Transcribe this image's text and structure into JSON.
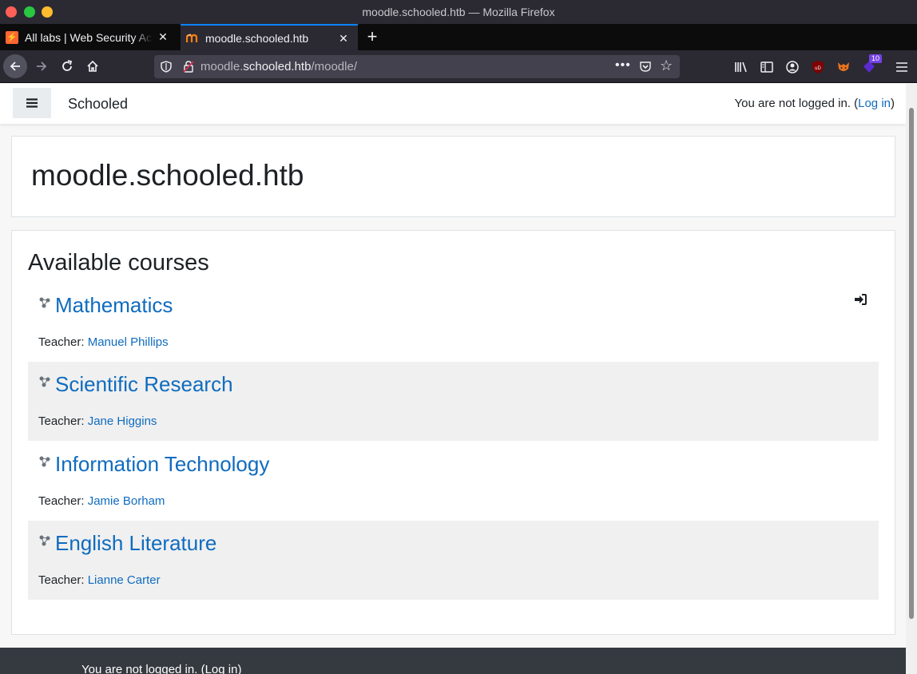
{
  "window": {
    "title": "moodle.schooled.htb — Mozilla Firefox"
  },
  "tabs": [
    {
      "label": "All labs | Web Security Academy",
      "favicon": "web-security-academy-icon"
    },
    {
      "label": "moodle.schooled.htb",
      "favicon": "moodle-icon",
      "active": true
    }
  ],
  "urlbar": {
    "host": "moodle.schooled.htb",
    "prefix": "moodle.",
    "domain": "schooled.htb",
    "path": "/moodle/"
  },
  "toolbar": {
    "extension_badge": "10"
  },
  "moodle_nav": {
    "site_name": "Schooled",
    "login_prefix": "You are not logged in. (",
    "login_link": "Log in",
    "login_suffix": ")"
  },
  "header": {
    "title": "moodle.schooled.htb"
  },
  "courses_section": {
    "title": "Available courses",
    "teacher_label": "Teacher: ",
    "courses": [
      {
        "name": "Mathematics",
        "teacher": "Manuel Phillips"
      },
      {
        "name": "Scientific Research",
        "teacher": "Jane Higgins"
      },
      {
        "name": "Information Technology",
        "teacher": "Jamie Borham"
      },
      {
        "name": "English Literature",
        "teacher": "Lianne Carter"
      }
    ]
  },
  "footer": {
    "login_prefix": "You are not logged in. (",
    "login_link": "Log in",
    "login_suffix": ")"
  },
  "colors": {
    "link": "#0f6cbf",
    "footer_bg": "#343a40",
    "browser_chrome": "#2b2a33"
  }
}
